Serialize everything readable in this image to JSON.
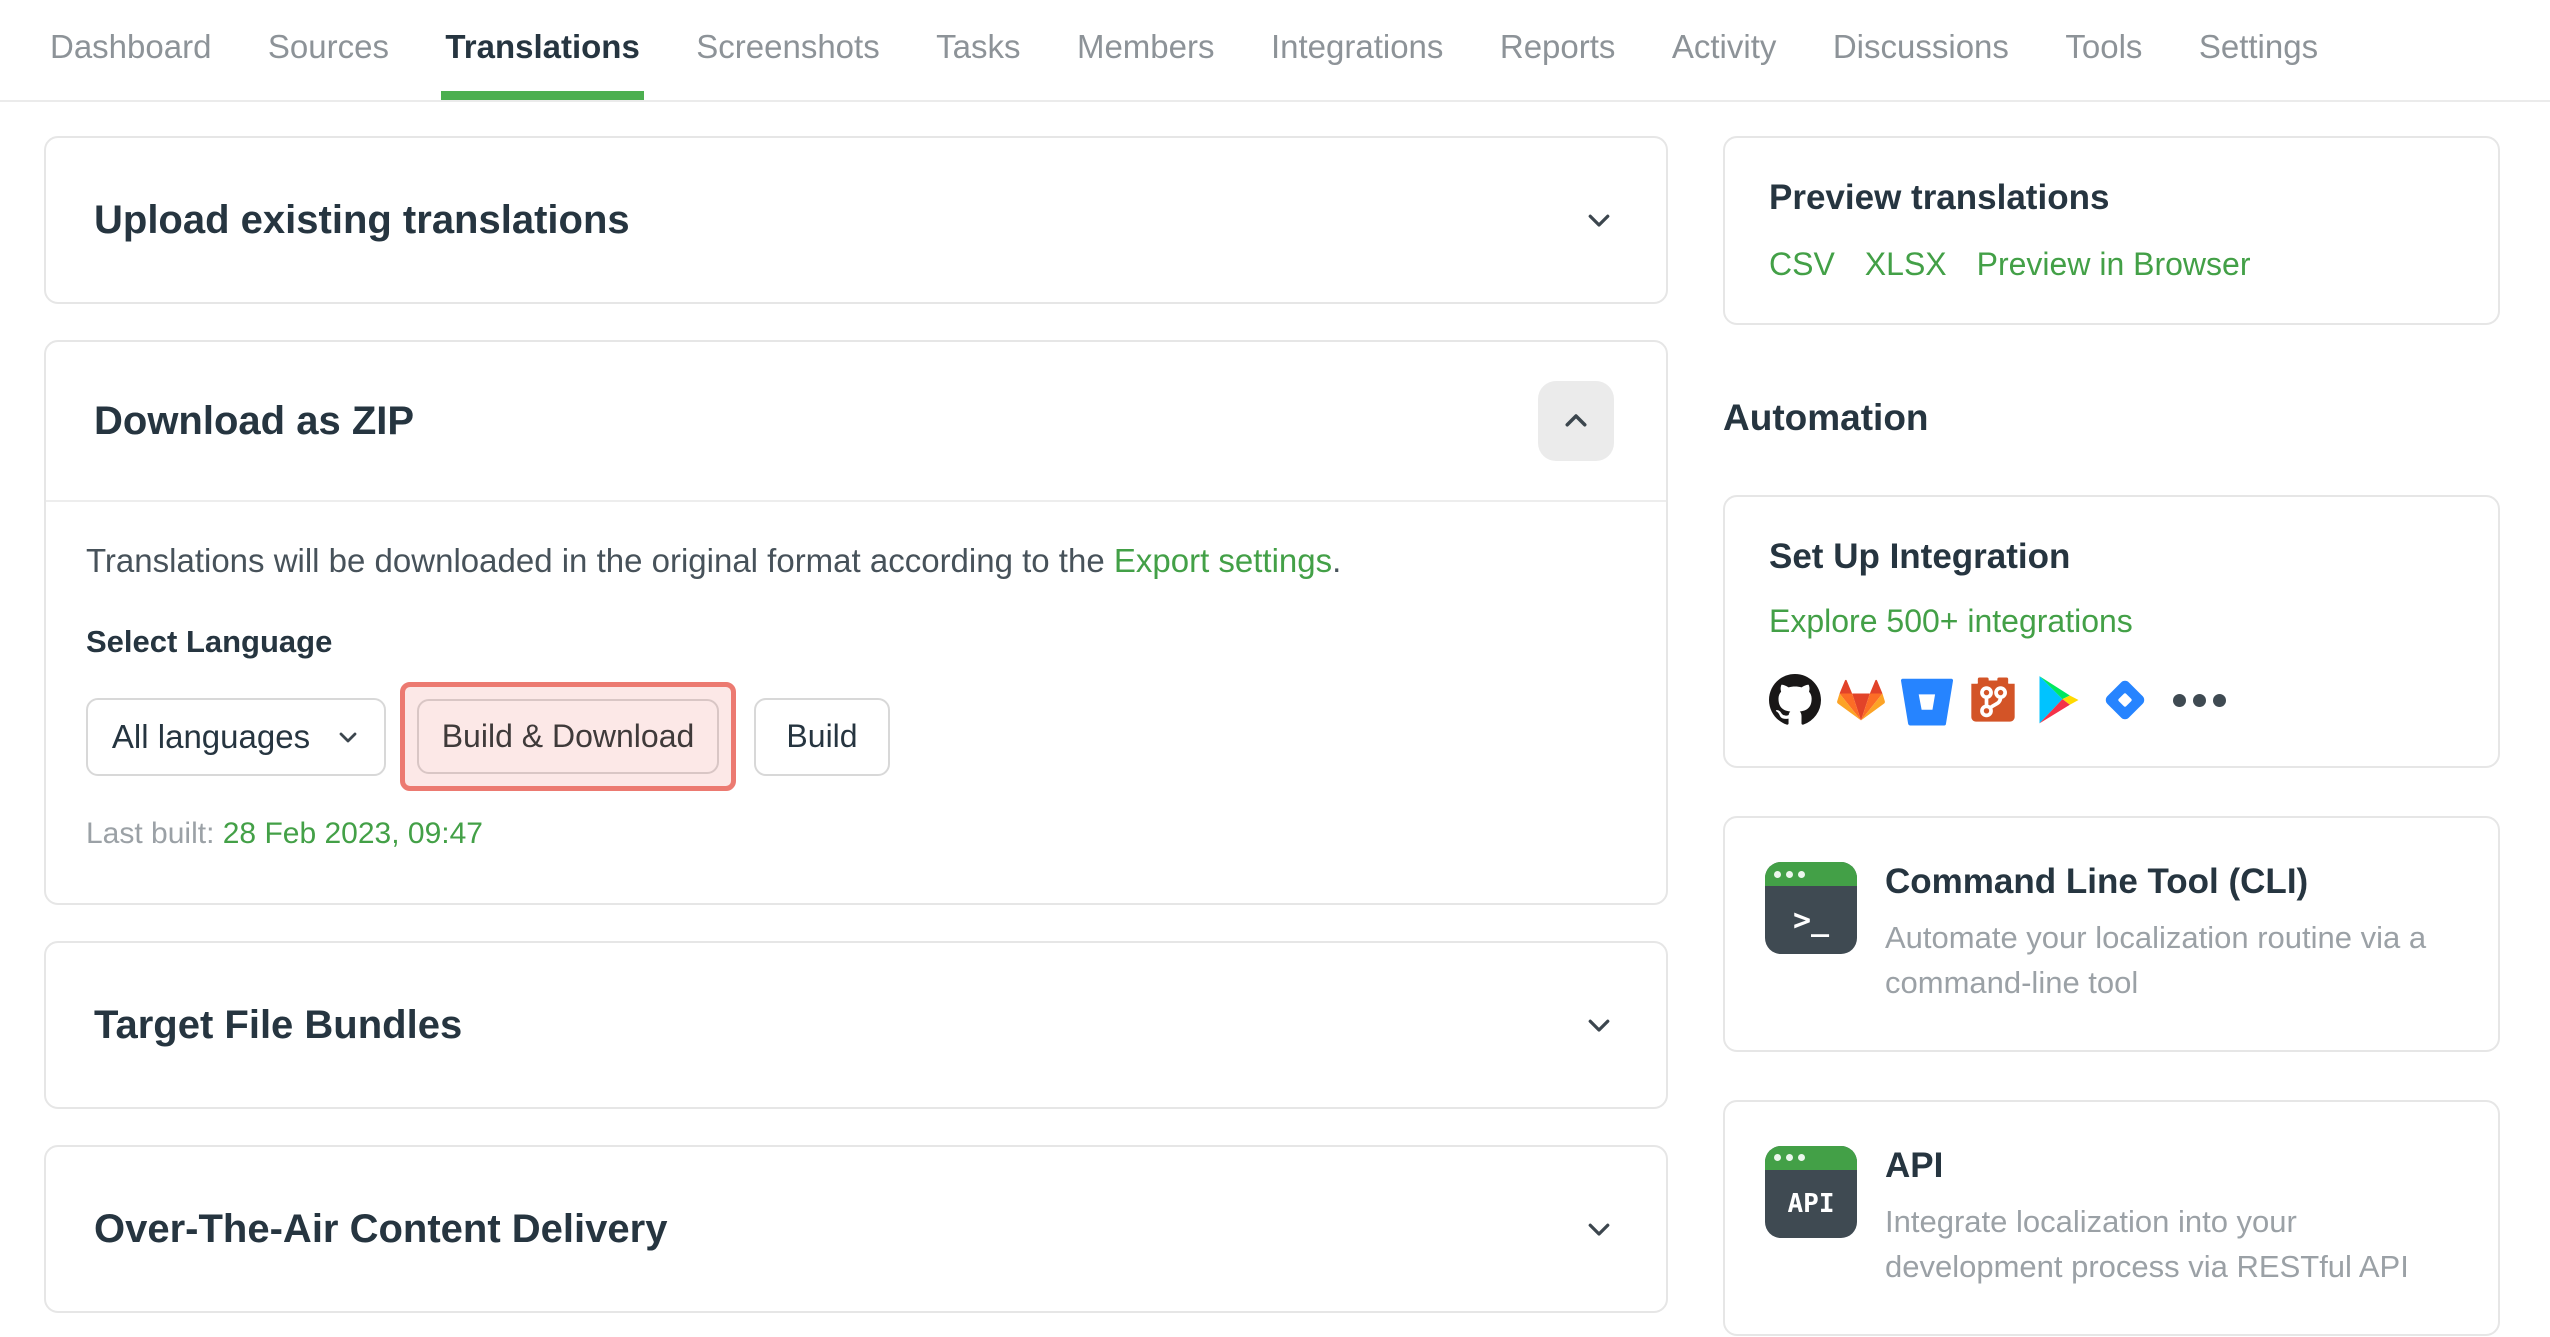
{
  "nav": {
    "items": [
      {
        "label": "Dashboard",
        "active": false
      },
      {
        "label": "Sources",
        "active": false
      },
      {
        "label": "Translations",
        "active": true
      },
      {
        "label": "Screenshots",
        "active": false
      },
      {
        "label": "Tasks",
        "active": false
      },
      {
        "label": "Members",
        "active": false
      },
      {
        "label": "Integrations",
        "active": false
      },
      {
        "label": "Reports",
        "active": false
      },
      {
        "label": "Activity",
        "active": false
      },
      {
        "label": "Discussions",
        "active": false
      },
      {
        "label": "Tools",
        "active": false
      },
      {
        "label": "Settings",
        "active": false
      }
    ]
  },
  "panels": {
    "upload": {
      "title": "Upload existing translations"
    },
    "download": {
      "title": "Download as ZIP",
      "description_prefix": "Translations will be downloaded in the original format according to the ",
      "description_link": "Export settings",
      "description_suffix": ".",
      "select_label": "Select Language",
      "language_value": "All languages",
      "build_download_label": "Build & Download",
      "build_label": "Build",
      "last_built_label": "Last built: ",
      "last_built_value": "28 Feb 2023, 09:47"
    },
    "bundles": {
      "title": "Target File Bundles"
    },
    "ota": {
      "title": "Over-The-Air Content Delivery"
    }
  },
  "sidebar": {
    "preview": {
      "title": "Preview translations",
      "links": [
        "CSV",
        "XLSX",
        "Preview in Browser"
      ]
    },
    "automation_heading": "Automation",
    "integration": {
      "title": "Set Up Integration",
      "link": "Explore 500+ integrations",
      "icon_names": [
        "github",
        "gitlab",
        "bitbucket",
        "git",
        "google-play",
        "jira",
        "more-options"
      ]
    },
    "cli": {
      "icon_text": ">_",
      "title": "Command Line Tool (CLI)",
      "description": "Automate your localization routine via a command-line tool"
    },
    "api": {
      "icon_text": "API",
      "title": "API",
      "description": "Integrate localization into your development process via RESTful API"
    }
  },
  "colors": {
    "accent_green": "#43a047",
    "tab_underline": "#4caf50",
    "highlight_border": "#ec7a71",
    "highlight_fill": "rgba(249,205,202,0.45)",
    "heading_dark": "#263540"
  }
}
